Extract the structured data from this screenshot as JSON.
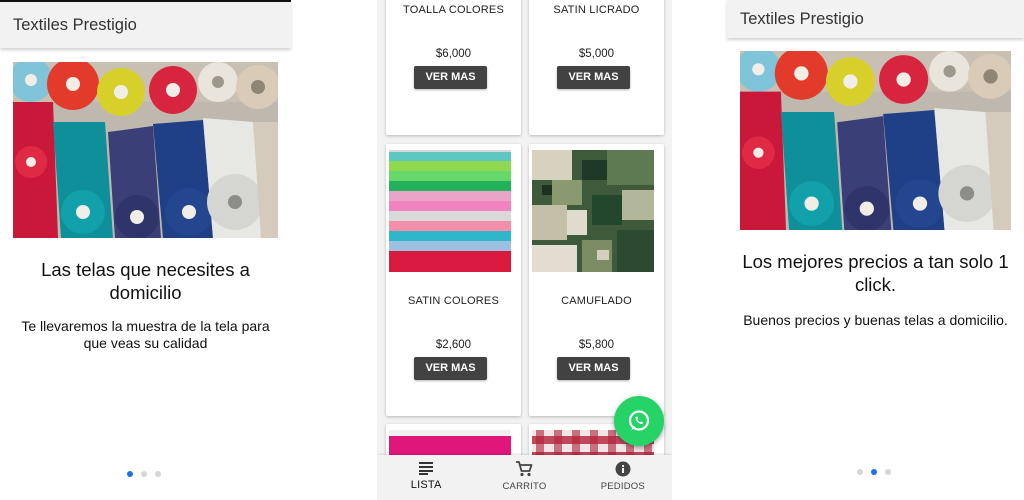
{
  "left_screen": {
    "appbar_title": "Textiles Prestigio",
    "slide_title": "Las telas que necesites a domicilio",
    "slide_body": "Te llevaremos la muestra de la tela para que veas su calidad",
    "active_dot": 0
  },
  "middle_screen": {
    "products": [
      {
        "name": "TOALLA COLORES",
        "price": "$6,000",
        "button": "VER MAS"
      },
      {
        "name": "SATIN LICRADO",
        "price": "$5,000",
        "button": "VER MAS"
      },
      {
        "name": "SATIN COLORES",
        "price": "$2,600",
        "button": "VER MAS"
      },
      {
        "name": "CAMUFLADO",
        "price": "$5,800",
        "button": "VER MAS"
      }
    ],
    "bottom_nav": [
      {
        "label": "LISTA",
        "icon": "list-icon",
        "active": true
      },
      {
        "label": "CARRITO",
        "icon": "cart-icon",
        "active": false
      },
      {
        "label": "PEDIDOS",
        "icon": "info-icon",
        "active": false
      }
    ],
    "fab_icon": "whatsapp-icon"
  },
  "right_screen": {
    "appbar_title": "Textiles Prestigio",
    "slide_title": "Los mejores precios a tan solo 1 click.",
    "slide_body": "Buenos precios y buenas telas a domicilio.",
    "active_dot": 1
  },
  "colors": {
    "accent_dot": "#1a73e8",
    "button_dark": "#424242",
    "whatsapp_green": "#25d366"
  }
}
